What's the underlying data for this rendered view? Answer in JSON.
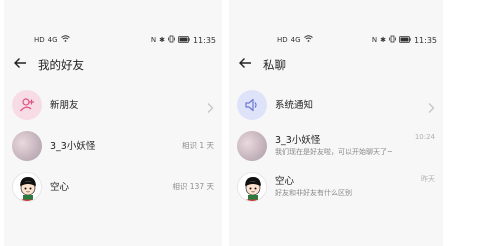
{
  "left": {
    "status": {
      "left_icons": [
        "HD",
        "4G",
        "WiFi"
      ],
      "right_icons": [
        "N",
        "✱",
        "vibrate",
        "battery"
      ],
      "time": "11:35"
    },
    "title": "我的好友",
    "items": [
      {
        "name": "新朋友",
        "meta": "",
        "icon": "add-user-icon"
      },
      {
        "name": "3_3小妖怪",
        "meta": "相识 1 天",
        "icon": "photo-avatar"
      },
      {
        "name": "空心",
        "meta": "相识 137 天",
        "icon": "cartoon-avatar"
      }
    ]
  },
  "right": {
    "status": {
      "left_icons": [
        "HD",
        "4G",
        "WiFi"
      ],
      "right_icons": [
        "N",
        "✱",
        "vibrate",
        "battery"
      ],
      "time": "11:35"
    },
    "title": "私聊",
    "items": [
      {
        "name": "系统通知",
        "preview": "",
        "time": "",
        "icon": "speaker-icon"
      },
      {
        "name": "3_3小妖怪",
        "preview": "我们现在是好友啦，可以开始聊天了~",
        "time": "10:24",
        "icon": "photo-avatar"
      },
      {
        "name": "空心",
        "preview": "好友和非好友有什么区别",
        "time": "昨天",
        "icon": "cartoon-avatar"
      }
    ]
  },
  "colors": {
    "new_friend_bg": "#f7dce6",
    "system_bg": "#dfe3fa",
    "accent": "#7b86d8"
  }
}
